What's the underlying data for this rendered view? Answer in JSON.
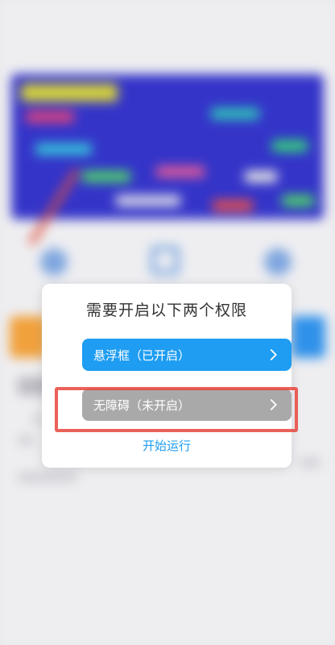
{
  "background": {
    "top_label": "",
    "banner_color": "#3434c9",
    "accent_orange": "#f1a13c",
    "accent_blue": "#2f91ea",
    "edit_icon": "edit-icon"
  },
  "dialog": {
    "title": "需要开启以下两个权限",
    "permissions": [
      {
        "label": "悬浮框（已开启）",
        "status": "enabled",
        "color": "#1e9df2",
        "icon": "chevron-right-icon"
      },
      {
        "label": "无障碍（未开启）",
        "status": "disabled",
        "color": "#a9a9a9",
        "icon": "chevron-right-icon"
      }
    ],
    "start_label": "开始运行",
    "highlight_color": "#e8453c"
  }
}
